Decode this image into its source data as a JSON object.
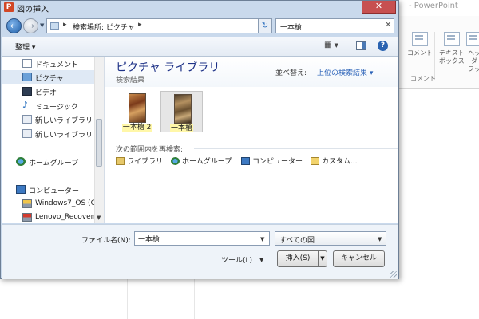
{
  "background_app": {
    "title": "- PowerPoint",
    "ribbon": {
      "comment_label": "コメント",
      "textbox_label_1": "テキスト",
      "textbox_label_2": "ボックス",
      "header_label_1": "ヘッダ",
      "header_label_2": "フッ",
      "group_label": "コメント"
    }
  },
  "dialog": {
    "title": "図の挿入",
    "app_icon_letter": "P",
    "address": {
      "path": "検索場所: ピクチャ"
    },
    "search": {
      "value": "一本槍"
    },
    "toolbar": {
      "organize_label": "整理 ▾"
    },
    "nav_pane": {
      "items": [
        {
          "label": "ドキュメント",
          "icon": "document-icon"
        },
        {
          "label": "ピクチャ",
          "icon": "pictures-icon",
          "selected": true
        },
        {
          "label": "ビデオ",
          "icon": "video-icon"
        },
        {
          "label": "ミュージック",
          "icon": "music-icon"
        },
        {
          "label": "新しいライブラリ",
          "icon": "library-icon"
        },
        {
          "label": "新しいライブラリ",
          "icon": "library-icon"
        },
        {
          "label": "ホームグループ",
          "icon": "homegroup-icon"
        },
        {
          "label": "コンピューター",
          "icon": "computer-icon"
        },
        {
          "label": "Windows7_OS (C",
          "icon": "drive-icon"
        },
        {
          "label": "Lenovo_Recoven",
          "icon": "drive-icon"
        }
      ]
    },
    "content": {
      "library_title": "ピクチャ ライブラリ",
      "library_subtitle": "検索結果",
      "arrange_label": "並べ替え:",
      "arrange_value": "上位の検索結果 ▾",
      "files": [
        {
          "name": "一本槍 2"
        },
        {
          "name": "一本槍",
          "selected": true
        }
      ],
      "search_again_label": "次の範囲内を再検索:",
      "search_again_items": [
        {
          "label": "ライブラリ",
          "icon": "library-folder-icon"
        },
        {
          "label": "ホームグループ",
          "icon": "homegroup-icon"
        },
        {
          "label": "コンピューター",
          "icon": "computer-icon"
        },
        {
          "label": "カスタム...",
          "icon": "custom-folder-icon"
        }
      ]
    },
    "bottom": {
      "filename_label": "ファイル名(N):",
      "filename_value": "一本槍",
      "filter_value": "すべての図",
      "tools_label": "ツール(L)",
      "insert_label": "挿入(S)",
      "cancel_label": "キャンセル"
    }
  }
}
